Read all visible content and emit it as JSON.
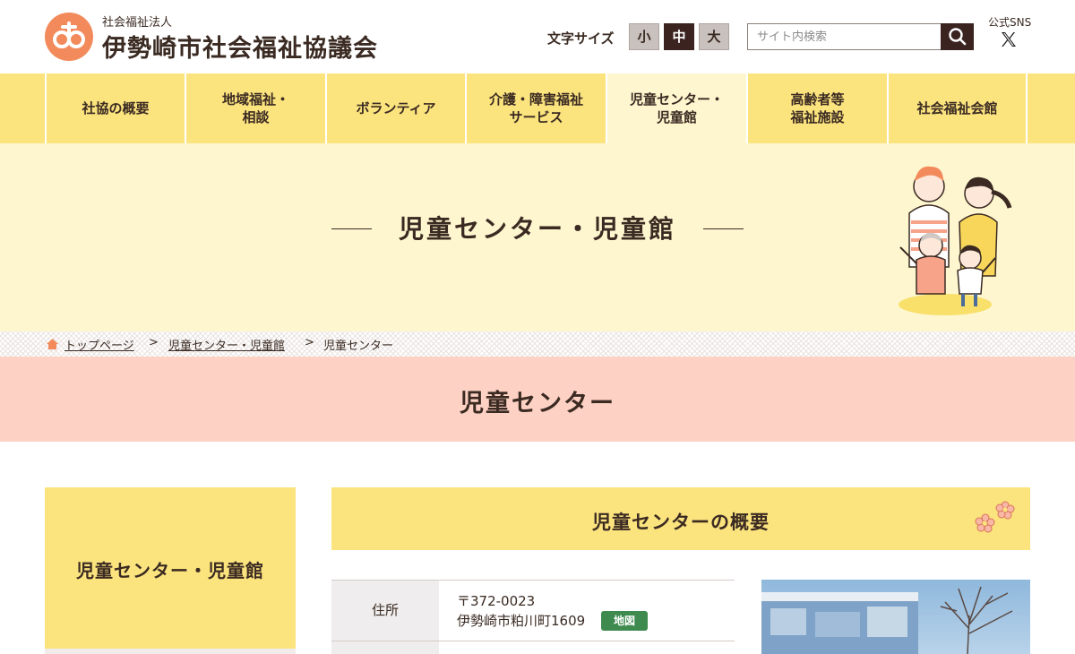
{
  "header": {
    "org_type": "社会福祉法人",
    "org_name": "伊勢崎市社会福祉協議会",
    "font_size_label": "文字サイズ",
    "font_sizes": [
      "小",
      "中",
      "大"
    ],
    "font_size_active": "中",
    "search_placeholder": "サイト内検索",
    "sns_label": "公式SNS"
  },
  "nav": {
    "items": [
      {
        "label": "社協の概要"
      },
      {
        "label": "地域福祉・\n相談"
      },
      {
        "label": "ボランティア"
      },
      {
        "label": "介護・障害福祉\nサービス"
      },
      {
        "label": "児童センター・\n児童館"
      },
      {
        "label": "高齢者等\n福祉施設"
      },
      {
        "label": "社会福祉会館"
      }
    ],
    "active_index": 4
  },
  "hero": {
    "title": "児童センター・児童館"
  },
  "breadcrumb": {
    "items": [
      "トップページ",
      "児童センター・児童館",
      "児童センター"
    ],
    "separator": ">"
  },
  "page": {
    "title": "児童センター"
  },
  "sidebar": {
    "title": "児童センター・児童館"
  },
  "main": {
    "section_title": "児童センターの概要",
    "table": {
      "rows": [
        {
          "label": "住所",
          "postal": "〒372-0023",
          "address": "伊勢崎市粕川町1609",
          "map_button": "地図"
        }
      ]
    }
  },
  "colors": {
    "accent_yellow": "#fbe37e",
    "hero_cream": "#fef6cf",
    "page_band_pink": "#fdd1c3",
    "dark_brown": "#3b2320",
    "map_green": "#3e8a4f",
    "logo_orange": "#f28a5c"
  },
  "icons": [
    "logo-icon",
    "search-icon",
    "x-icon",
    "home-icon",
    "flower-icon"
  ]
}
